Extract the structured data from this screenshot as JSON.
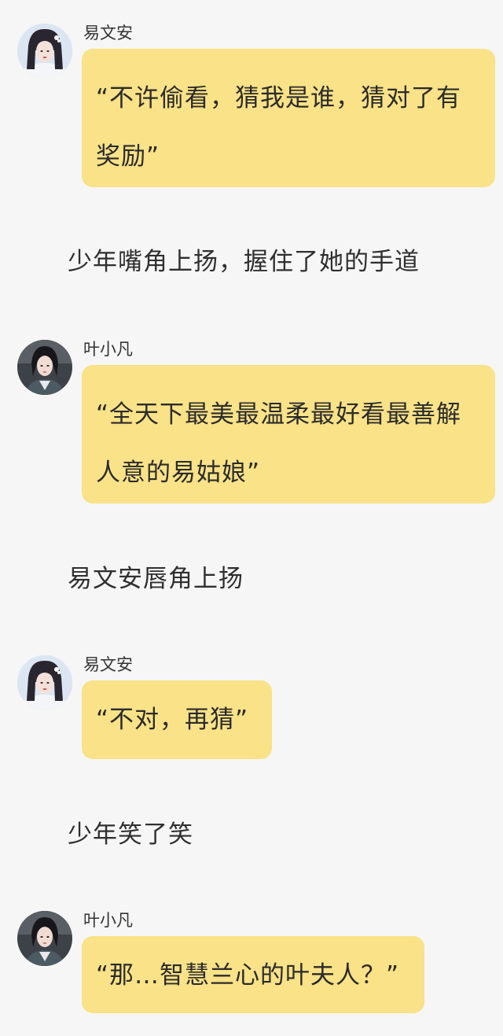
{
  "colors": {
    "background": "#f6f6f6",
    "bubble": "#f9e287",
    "text": "#2b2b2b"
  },
  "messages": [
    {
      "speaker": "易文安",
      "text": "“不许偷看，猜我是谁，猜对了有奖励”",
      "avatar": "female-avatar"
    },
    {
      "narration": "少年嘴角上扬，握住了她的手道"
    },
    {
      "speaker": "叶小凡",
      "text": "“全天下最美最温柔最好看最善解人意的易姑娘”",
      "avatar": "male-avatar"
    },
    {
      "narration": "易文安唇角上扬"
    },
    {
      "speaker": "易文安",
      "text": "“不对，再猜”",
      "avatar": "female-avatar"
    },
    {
      "narration": "少年笑了笑"
    },
    {
      "speaker": "叶小凡",
      "text": "“那…智慧兰心的叶夫人？”",
      "avatar": "male-avatar"
    }
  ]
}
